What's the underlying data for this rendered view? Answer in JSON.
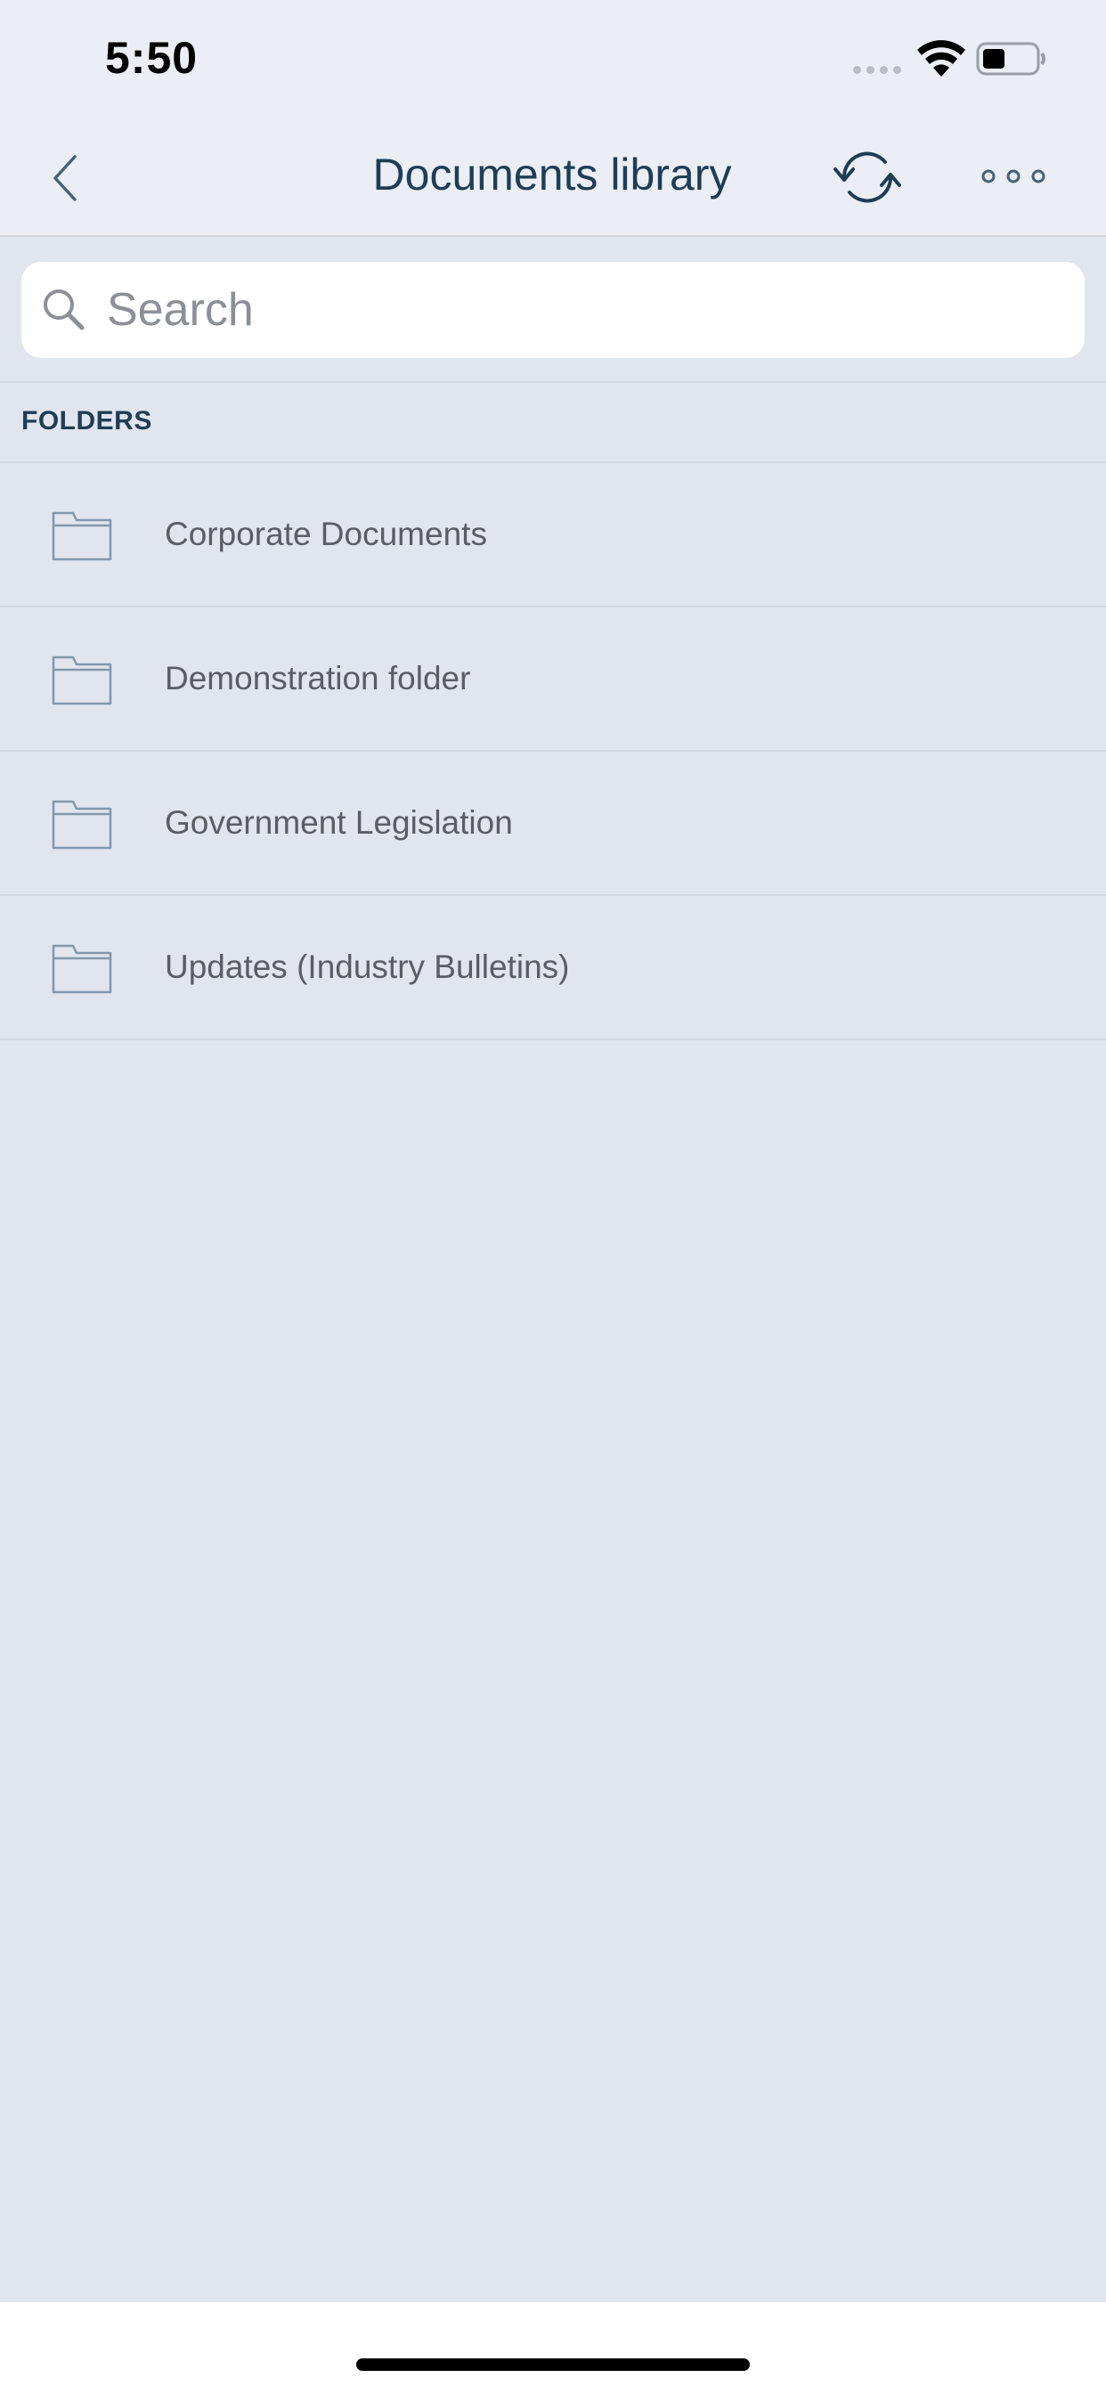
{
  "status_bar": {
    "time": "5:50"
  },
  "nav": {
    "title": "Documents library",
    "back_icon": "chevron-left-icon",
    "sync_icon": "sync-icon",
    "more_icon": "more-horizontal-icon"
  },
  "search": {
    "placeholder": "Search",
    "value": ""
  },
  "folders_section": {
    "header": "FOLDERS",
    "items": [
      {
        "label": "Corporate Documents",
        "icon": "folder-icon"
      },
      {
        "label": "Demonstration folder",
        "icon": "folder-icon"
      },
      {
        "label": "Government Legislation",
        "icon": "folder-icon"
      },
      {
        "label": "Updates (Industry Bulletins)",
        "icon": "folder-icon"
      }
    ]
  },
  "colors": {
    "background": "#e1e5ee",
    "header_background": "#ebeef4",
    "title_text": "#1e3d56",
    "folder_text": "#5a5d62",
    "folder_icon": "#8197ab",
    "divider": "#d3d8e1"
  }
}
